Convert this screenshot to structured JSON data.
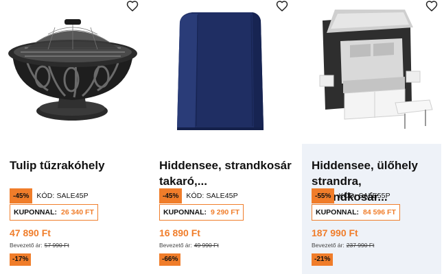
{
  "products": [
    {
      "title": "Tulip tűzrakóhely",
      "badge_pct": "-45%",
      "code": "KÓD: SALE45P",
      "coupon_label": "KUPONNAL:",
      "coupon_price": "26 340 FT",
      "price": "47 890 Ft",
      "intro_label": "Bevezető ár:",
      "intro_price": "57 990 Ft",
      "discount": "-17%",
      "image_icon": "fire-pit-image"
    },
    {
      "title": "Hiddensee, strandkosár takaró,...",
      "badge_pct": "-45%",
      "code": "KÓD: SALE45P",
      "coupon_label": "KUPONNAL:",
      "coupon_price": "9 290 FT",
      "price": "16 890 Ft",
      "intro_label": "Bevezető ár:",
      "intro_price": "49 990 Ft",
      "discount": "-66%",
      "image_icon": "beach-chair-cover-image"
    },
    {
      "title": "Hiddensee, ülőhely strandra, strandkosár...",
      "badge_pct": "-55%",
      "code": "KÓD: SALE55P",
      "coupon_label": "KUPONNAL:",
      "coupon_price": "84 596 FT",
      "price": "187 990 Ft",
      "intro_label": "Bevezető ár:",
      "intro_price": "237 990 Ft",
      "discount": "-21%",
      "image_icon": "beach-chair-image"
    }
  ],
  "colors": {
    "accent": "#f07d2a",
    "highlight_bg": "#eef2f8",
    "text": "#111111"
  },
  "icons": {
    "wishlist": "heart-outline-icon"
  }
}
